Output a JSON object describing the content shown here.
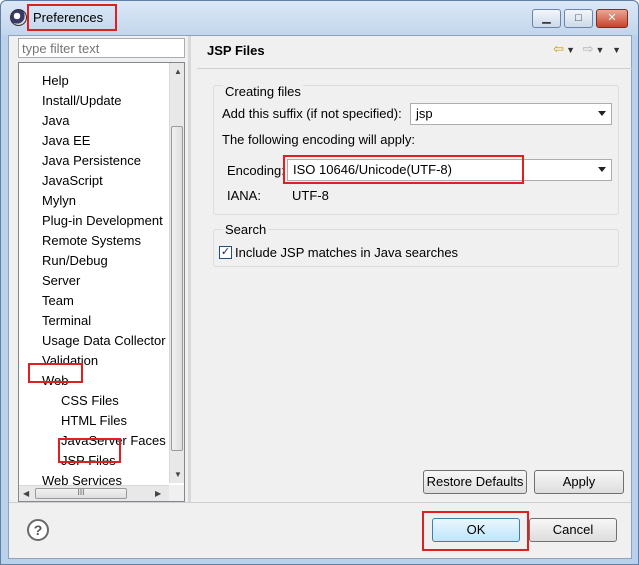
{
  "window": {
    "title": "Preferences",
    "minimize_glyph": "▁",
    "maximize_glyph": "□",
    "close_glyph": "✕"
  },
  "filter": {
    "placeholder": "type filter text"
  },
  "tree": {
    "items": [
      {
        "label": "Help"
      },
      {
        "label": "Install/Update"
      },
      {
        "label": "Java"
      },
      {
        "label": "Java EE"
      },
      {
        "label": "Java Persistence"
      },
      {
        "label": "JavaScript"
      },
      {
        "label": "Mylyn"
      },
      {
        "label": "Plug-in Development"
      },
      {
        "label": "Remote Systems"
      },
      {
        "label": "Run/Debug"
      },
      {
        "label": "Server"
      },
      {
        "label": "Team"
      },
      {
        "label": "Terminal"
      },
      {
        "label": "Usage Data Collector"
      },
      {
        "label": "Validation"
      },
      {
        "label": "Web"
      },
      {
        "label": "CSS Files"
      },
      {
        "label": "HTML Files"
      },
      {
        "label": "JavaServer Faces T"
      },
      {
        "label": "JSP Files"
      },
      {
        "label": "Web Services"
      }
    ],
    "hscroll_grip": "III"
  },
  "page": {
    "title": "JSP Files",
    "nav_back": "⇦",
    "nav_forward": "⇨",
    "nav_menu": "▼"
  },
  "creating_files": {
    "group_label": "Creating files",
    "suffix_label": "Add this suffix (if not specified):",
    "suffix_value": "jsp",
    "encoding_note": "The following encoding will apply:",
    "encoding_label": "Encoding:",
    "encoding_value": "ISO 10646/Unicode(UTF-8)",
    "iana_label": "IANA:",
    "iana_value": "UTF-8"
  },
  "search": {
    "group_label": "Search",
    "include_label": "Include JSP matches in Java searches",
    "include_checked": true,
    "check_glyph": "✓"
  },
  "buttons": {
    "restore_defaults": "Restore Defaults",
    "apply": "Apply",
    "ok": "OK",
    "cancel": "Cancel",
    "help": "?"
  },
  "colors": {
    "highlight_box": "#e02020",
    "title_bar": "#c2d6ec"
  }
}
